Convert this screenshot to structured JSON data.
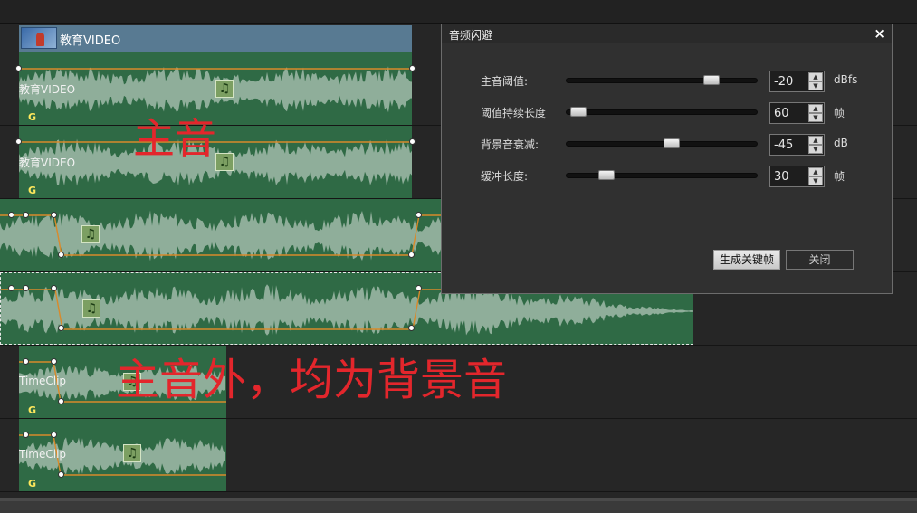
{
  "video_clip": {
    "label": "教育VIDEO"
  },
  "audio_clips": [
    {
      "label": "教育VIDEO",
      "tag": "G"
    },
    {
      "label": "教育VIDEO",
      "tag": "G"
    },
    {
      "label": "",
      "tag": ""
    },
    {
      "label": "",
      "tag": ""
    },
    {
      "label": "TimeClip",
      "tag": "G"
    },
    {
      "label": "TimeClip",
      "tag": "G"
    }
  ],
  "annotations": {
    "main_audio": "主音",
    "background_audio": "主音外，均为背景音"
  },
  "dialog": {
    "title": "音频闪避",
    "close_symbol": "×",
    "rows": [
      {
        "label": "主音阈值:",
        "value": "-20",
        "unit": "dBfs",
        "slider_fraction": 0.78
      },
      {
        "label": "阈值持续长度",
        "value": "60",
        "unit": "帧",
        "slider_fraction": 0.02
      },
      {
        "label": "背景音衰减:",
        "value": "-45",
        "unit": "dB",
        "slider_fraction": 0.55
      },
      {
        "label": "缓冲长度:",
        "value": "30",
        "unit": "帧",
        "slider_fraction": 0.18
      }
    ],
    "generate_button": "生成关键帧",
    "close_button": "关闭"
  },
  "icons": {
    "music_note": "♫"
  },
  "colors": {
    "clip_green": "#2f6a45",
    "waveform": "#8fae9a",
    "envelope": "#d98a2b",
    "video_clip": "#587a92",
    "annotation_red": "#e3262c"
  }
}
